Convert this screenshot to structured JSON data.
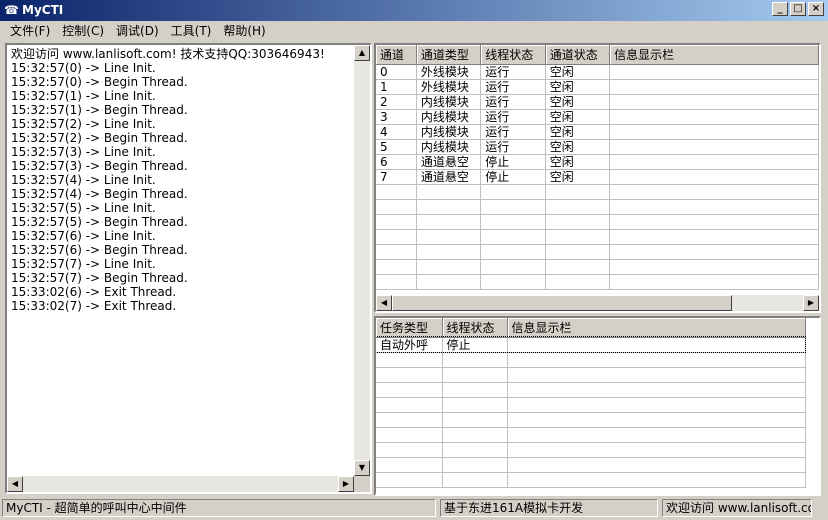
{
  "titlebar": {
    "title": "MyCTI",
    "icon": "phone-icon"
  },
  "menu": [
    "文件(F)",
    "控制(C)",
    "调试(D)",
    "工具(T)",
    "帮助(H)"
  ],
  "log_lines": [
    "欢迎访问 www.lanlisoft.com! 技术支持QQ:303646943!",
    "15:32:57(0) -> Line Init.",
    "15:32:57(0) -> Begin Thread.",
    "15:32:57(1) -> Line Init.",
    "15:32:57(1) -> Begin Thread.",
    "15:32:57(2) -> Line Init.",
    "15:32:57(2) -> Begin Thread.",
    "15:32:57(3) -> Line Init.",
    "15:32:57(3) -> Begin Thread.",
    "15:32:57(4) -> Line Init.",
    "15:32:57(4) -> Begin Thread.",
    "15:32:57(5) -> Line Init.",
    "15:32:57(5) -> Begin Thread.",
    "15:32:57(6) -> Line Init.",
    "15:32:57(6) -> Begin Thread.",
    "15:32:57(7) -> Line Init.",
    "15:32:57(7) -> Begin Thread.",
    "15:33:02(6) -> Exit Thread.",
    "15:33:02(7) -> Exit Thread."
  ],
  "channels": {
    "headers": [
      "通道",
      "通道类型",
      "线程状态",
      "通道状态",
      "信息显示栏"
    ],
    "rows": [
      [
        "0",
        "外线模块",
        "运行",
        "空闲",
        ""
      ],
      [
        "1",
        "外线模块",
        "运行",
        "空闲",
        ""
      ],
      [
        "2",
        "内线模块",
        "运行",
        "空闲",
        ""
      ],
      [
        "3",
        "内线模块",
        "运行",
        "空闲",
        ""
      ],
      [
        "4",
        "内线模块",
        "运行",
        "空闲",
        ""
      ],
      [
        "5",
        "内线模块",
        "运行",
        "空闲",
        ""
      ],
      [
        "6",
        "通道悬空",
        "停止",
        "空闲",
        ""
      ],
      [
        "7",
        "通道悬空",
        "停止",
        "空闲",
        ""
      ]
    ]
  },
  "tasks": {
    "headers": [
      "任务类型",
      "线程状态",
      "信息显示栏"
    ],
    "rows": [
      [
        "自动外呼",
        "停止",
        ""
      ]
    ]
  },
  "status": [
    "MyCTI - 超简单的呼叫中心中间件",
    "基于东进161A模拟卡开发",
    "欢迎访问 www.lanlisoft.com!"
  ]
}
